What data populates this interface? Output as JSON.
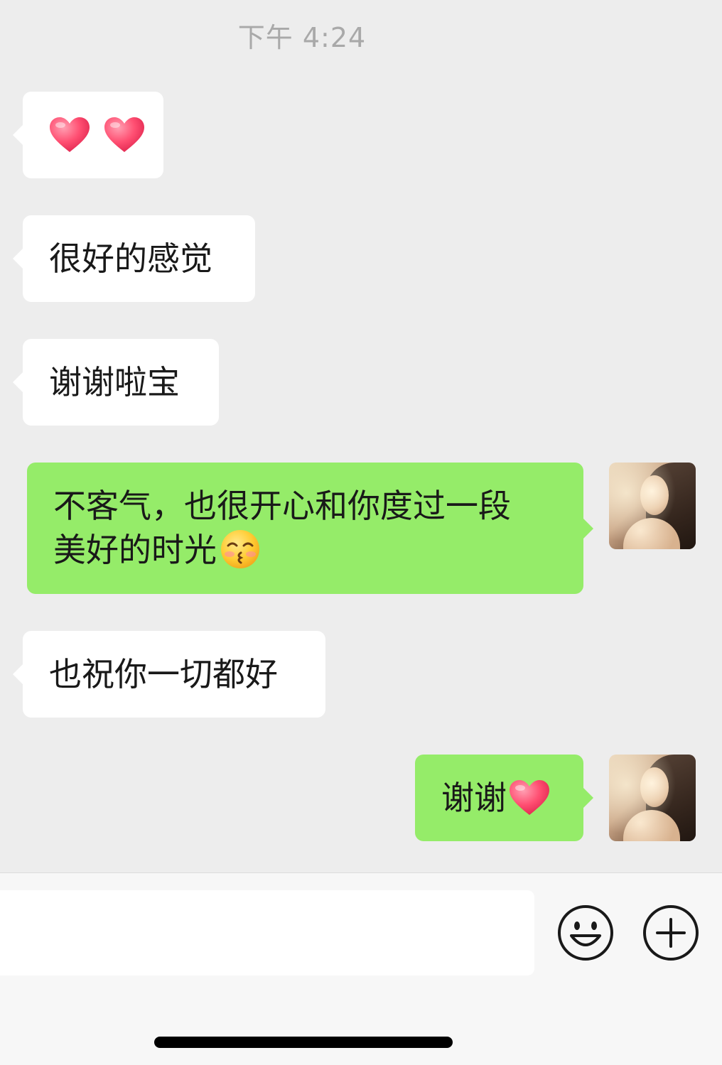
{
  "timestamp": "下午 4:24",
  "messages": [
    {
      "direction": "incoming",
      "text": "",
      "emoji": [
        "red-heart",
        "red-heart"
      ]
    },
    {
      "direction": "incoming",
      "text": "很好的感觉"
    },
    {
      "direction": "incoming",
      "text": "谢谢啦宝"
    },
    {
      "direction": "outgoing",
      "line1": "不客气，也很开心和你度过一段",
      "line2": "美好的时光",
      "emoji": [
        "kissing-smiling-eyes"
      ]
    },
    {
      "direction": "incoming",
      "text": "也祝你一切都好"
    },
    {
      "direction": "outgoing",
      "text": "谢谢",
      "emoji": [
        "red-heart"
      ]
    }
  ],
  "colors": {
    "background": "#ededed",
    "incoming_bubble": "#ffffff",
    "outgoing_bubble": "#95ec69",
    "timestamp_text": "#a9a9a9"
  },
  "input_bar": {
    "text_value": "",
    "icons": [
      "emoji-icon",
      "plus-icon"
    ]
  }
}
